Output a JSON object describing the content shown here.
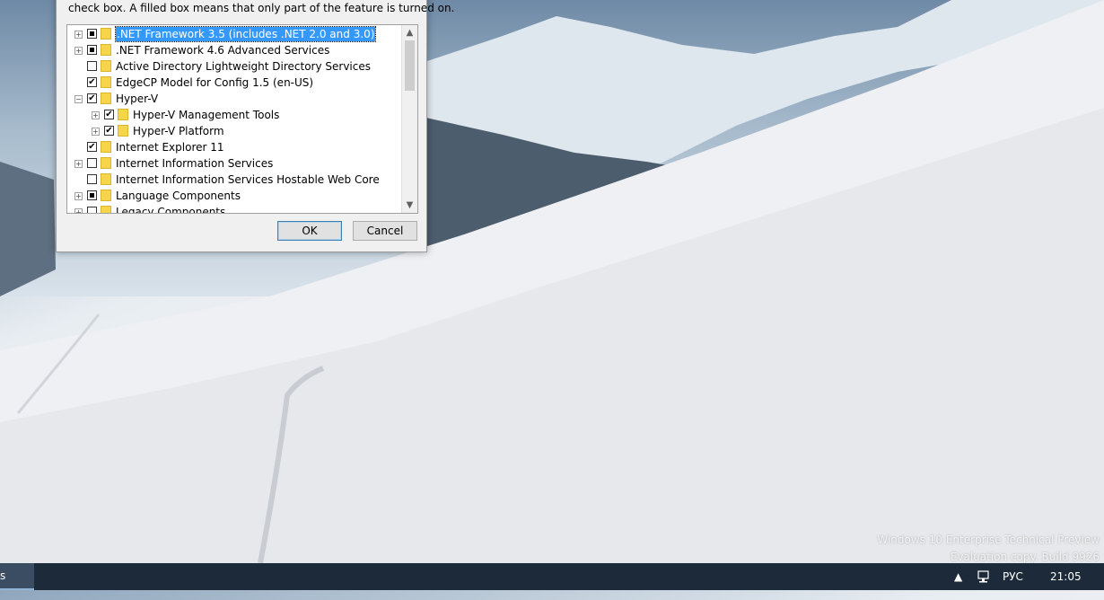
{
  "dialog": {
    "description": "check box. A filled box means that only part of the feature is turned on.",
    "features": [
      {
        "label": ".NET Framework 3.5 (includes .NET 2.0 and 3.0)",
        "expander": "+",
        "check": "partial",
        "selected": true,
        "indent": 0
      },
      {
        "label": ".NET Framework 4.6 Advanced Services",
        "expander": "+",
        "check": "partial",
        "selected": false,
        "indent": 0
      },
      {
        "label": "Active Directory Lightweight Directory Services",
        "expander": "",
        "check": "unchecked",
        "selected": false,
        "indent": 0
      },
      {
        "label": "EdgeCP Model for Config 1.5 (en-US)",
        "expander": "",
        "check": "checked",
        "selected": false,
        "indent": 0
      },
      {
        "label": "Hyper-V",
        "expander": "−",
        "check": "checked",
        "selected": false,
        "indent": 0
      },
      {
        "label": "Hyper-V Management Tools",
        "expander": "+",
        "check": "checked",
        "selected": false,
        "indent": 1
      },
      {
        "label": "Hyper-V Platform",
        "expander": "+",
        "check": "checked",
        "selected": false,
        "indent": 1
      },
      {
        "label": "Internet Explorer 11",
        "expander": "",
        "check": "checked",
        "selected": false,
        "indent": 0
      },
      {
        "label": "Internet Information Services",
        "expander": "+",
        "check": "unchecked",
        "selected": false,
        "indent": 0
      },
      {
        "label": "Internet Information Services Hostable Web Core",
        "expander": "",
        "check": "unchecked",
        "selected": false,
        "indent": 0
      },
      {
        "label": "Language Components",
        "expander": "+",
        "check": "partial",
        "selected": false,
        "indent": 0
      },
      {
        "label": "Legacy Components",
        "expander": "+",
        "check": "unchecked",
        "selected": false,
        "indent": 0
      }
    ],
    "ok_label": "OK",
    "cancel_label": "Cancel",
    "scroll_up_icon": "▲",
    "scroll_down_icon": "▼"
  },
  "watermark": {
    "line1": "Windows 10 Enterprise Technical Preview",
    "line2": "Evaluation copy. Build 9926"
  },
  "taskbar": {
    "app_label": "s",
    "tray_arrow": "▲",
    "language": "РУС",
    "time": "21:05"
  },
  "colors": {
    "selection": "#3399ff",
    "taskbar": "#1c2a3a",
    "folder": "#f6d54a"
  }
}
